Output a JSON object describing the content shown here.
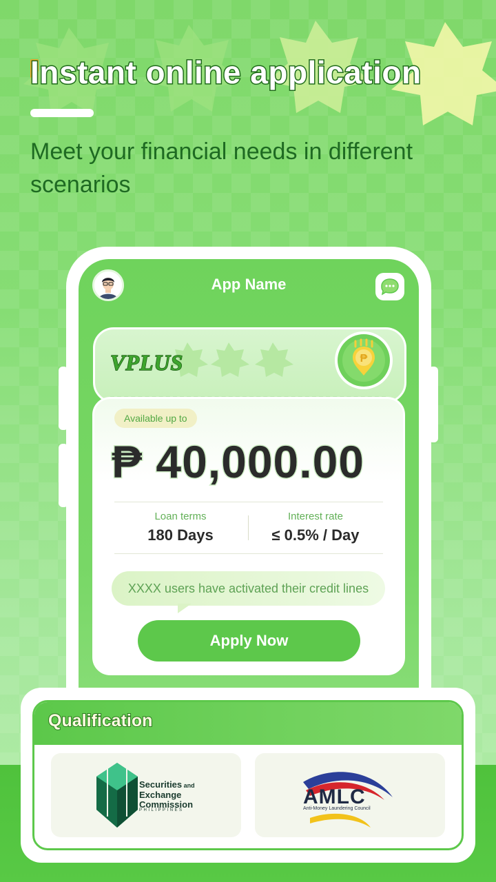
{
  "headline": {
    "first_letter": "I",
    "rest": "nstant online application"
  },
  "subheadline": "Meet your financial needs in different scenarios",
  "app": {
    "title": "App Name",
    "brand": "VPLUS",
    "currency_symbol": "₱"
  },
  "loan": {
    "available_label": "Available up to",
    "amount": "₱ 40,000.00",
    "terms_label": "Loan terms",
    "terms_value": "180 Days",
    "rate_label": "Interest rate",
    "rate_value": "≤ 0.5% / Day",
    "users_note": "XXXX users have activated their credit lines",
    "apply_label": "Apply Now"
  },
  "qualification": {
    "title": "Qualification",
    "sec": {
      "line1": "Securities",
      "line1_small": " and",
      "line2": "Exchange",
      "line3": "Commission",
      "country": "PHILIPPINES"
    },
    "amlc": {
      "name": "AMLC",
      "full": "Anti-Money Laundering Council"
    }
  },
  "colors": {
    "primary_green": "#5dc84b",
    "dark_green": "#1e6a22",
    "accent_orange": "#f3a32a"
  }
}
